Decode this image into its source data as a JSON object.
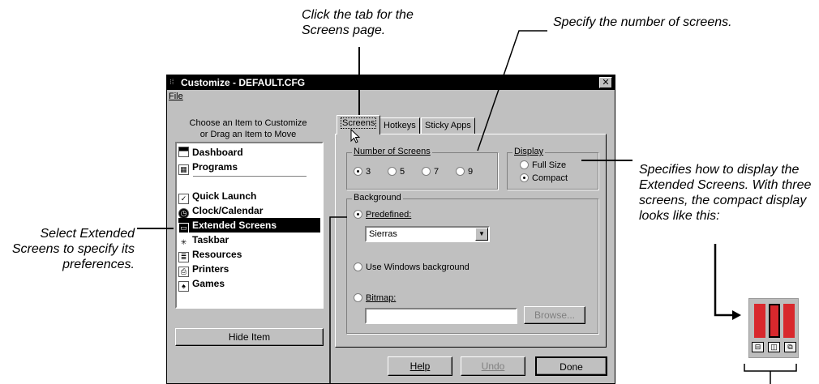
{
  "callouts": {
    "tab": "Click the tab for the Screens page.",
    "number": "Specify the number of screens.",
    "display": "Specifies how to display the Extended Screens. With three screens, the compact display looks like this:",
    "select": "Select Extended Screens to specify its preferences."
  },
  "window": {
    "title": "Customize - DEFAULT.CFG",
    "close": "✕",
    "menu_file": "File"
  },
  "left_panel": {
    "label_line1": "Choose an Item to Customize",
    "label_line2": "or Drag an Item to Move",
    "items": [
      {
        "label": "Dashboard",
        "icon": "dashboard-icon"
      },
      {
        "label": "Programs",
        "icon": "programs-icon"
      },
      {
        "label": "Quick Launch",
        "icon": "quick-launch-icon"
      },
      {
        "label": "Clock/Calendar",
        "icon": "clock-icon"
      },
      {
        "label": "Extended Screens",
        "icon": "extended-screens-icon",
        "selected": true
      },
      {
        "label": "Taskbar",
        "icon": "taskbar-icon"
      },
      {
        "label": "Resources",
        "icon": "resources-icon"
      },
      {
        "label": "Printers",
        "icon": "printers-icon"
      },
      {
        "label": "Games",
        "icon": "games-icon"
      }
    ],
    "hide_button": "Hide Item"
  },
  "tabs": [
    "Screens",
    "Hotkeys",
    "Sticky Apps"
  ],
  "number_of_screens": {
    "label": "Number of Screens",
    "options": [
      "3",
      "5",
      "7",
      "9"
    ],
    "selected": "3"
  },
  "display": {
    "label": "Display",
    "options": [
      "Full Size",
      "Compact"
    ],
    "selected": "Compact"
  },
  "background": {
    "label": "Background",
    "predefined_label": "Predefined:",
    "predefined_value": "Sierras",
    "windows_label": "Use Windows background",
    "bitmap_label": "Bitmap:",
    "bitmap_value": "",
    "browse_button": "Browse..."
  },
  "buttons": {
    "help": "Help",
    "undo": "Undo",
    "done": "Done"
  },
  "colors": {
    "screen_bar": "#d8282d",
    "screen_bar_active": "#000000"
  }
}
